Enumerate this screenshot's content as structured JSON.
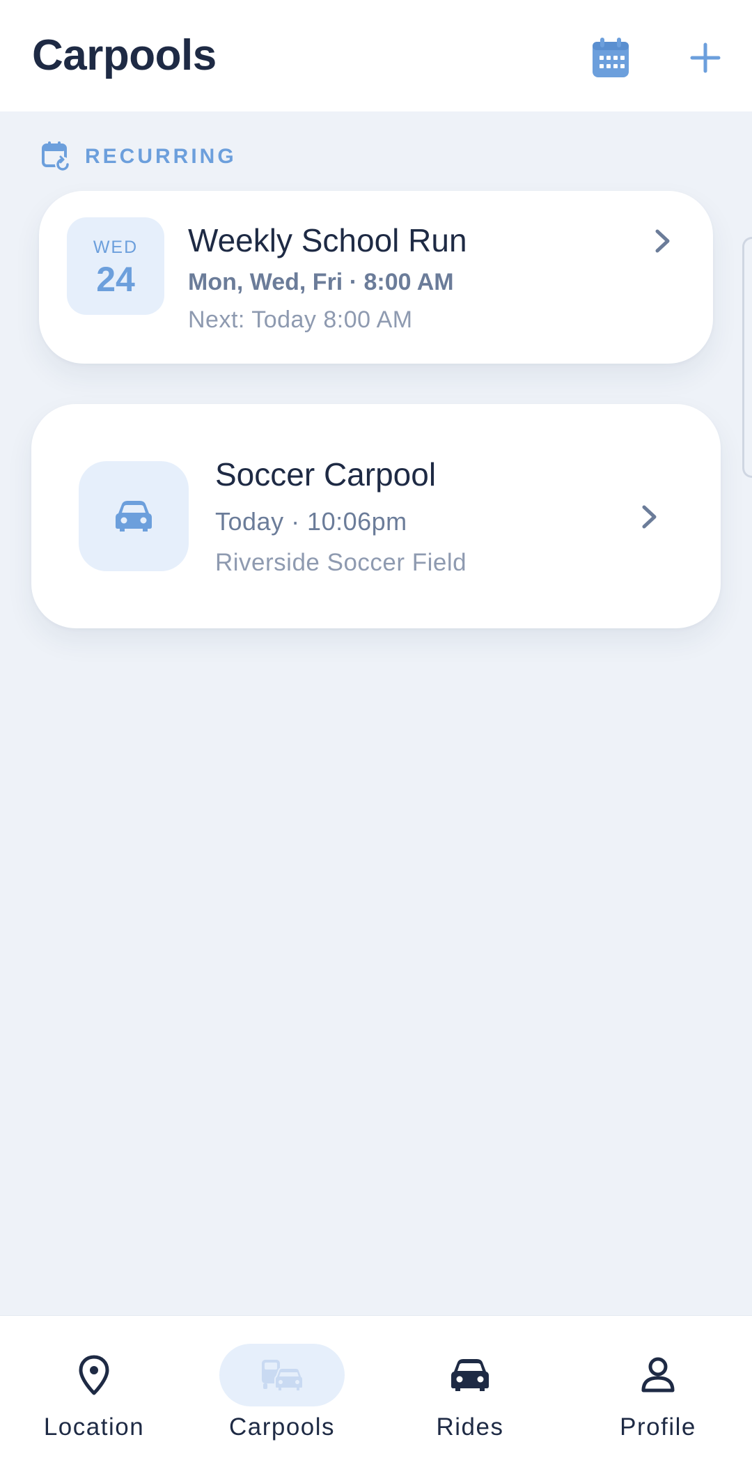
{
  "header": {
    "title": "Carpools",
    "calendar_icon": "calendar-icon",
    "add_icon": "plus-icon"
  },
  "section": {
    "icon": "calendar-recurring-icon",
    "label": "RECURRING"
  },
  "recurring_card": {
    "day_of_week": "WED",
    "day_number": "24",
    "title": "Weekly School Run",
    "schedule": "Mon, Wed, Fri · 8:00 AM",
    "next": "Next: Today 8:00 AM"
  },
  "carpool_card": {
    "icon": "car-icon",
    "title": "Soccer Carpool",
    "time": "Today · 10:06pm",
    "location": "Riverside Soccer Field"
  },
  "bottom_nav": {
    "items": [
      {
        "label": "Location",
        "icon": "map-pin-icon",
        "active": false
      },
      {
        "label": "Carpools",
        "icon": "carpools-icon",
        "active": true
      },
      {
        "label": "Rides",
        "icon": "car-icon",
        "active": false
      },
      {
        "label": "Profile",
        "icon": "user-icon",
        "active": false
      }
    ]
  },
  "colors": {
    "accent": "#6c9fdc",
    "accent_bg": "#e6effb",
    "text_primary": "#1e2a44",
    "text_secondary": "#6b7c99",
    "background": "#eef2f8"
  }
}
